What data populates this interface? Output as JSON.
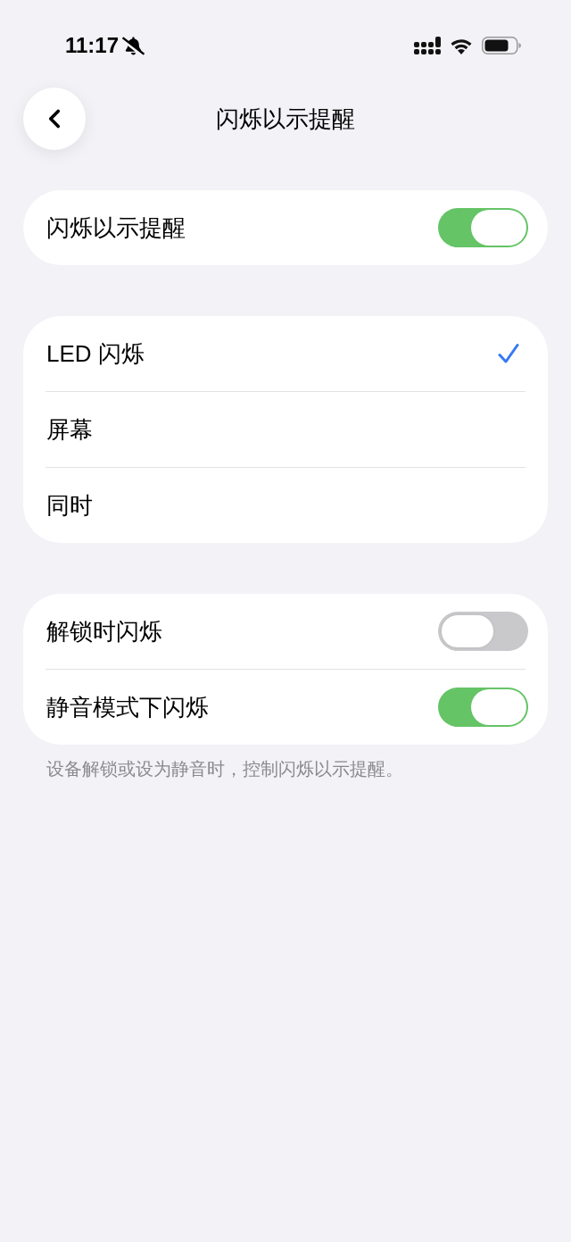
{
  "status_bar": {
    "time": "11:17"
  },
  "nav": {
    "title": "闪烁以示提醒"
  },
  "sections": [
    {
      "rows": [
        {
          "kind": "toggle",
          "label": "闪烁以示提醒",
          "on": true
        }
      ]
    },
    {
      "rows": [
        {
          "kind": "choice",
          "label": "LED 闪烁",
          "selected": true
        },
        {
          "kind": "choice",
          "label": "屏幕",
          "selected": false
        },
        {
          "kind": "choice",
          "label": "同时",
          "selected": false
        }
      ]
    },
    {
      "rows": [
        {
          "kind": "toggle",
          "label": "解锁时闪烁",
          "on": false
        },
        {
          "kind": "toggle",
          "label": "静音模式下闪烁",
          "on": true
        }
      ],
      "footer": "设备解锁或设为静音时，控制闪烁以示提醒。"
    }
  ]
}
